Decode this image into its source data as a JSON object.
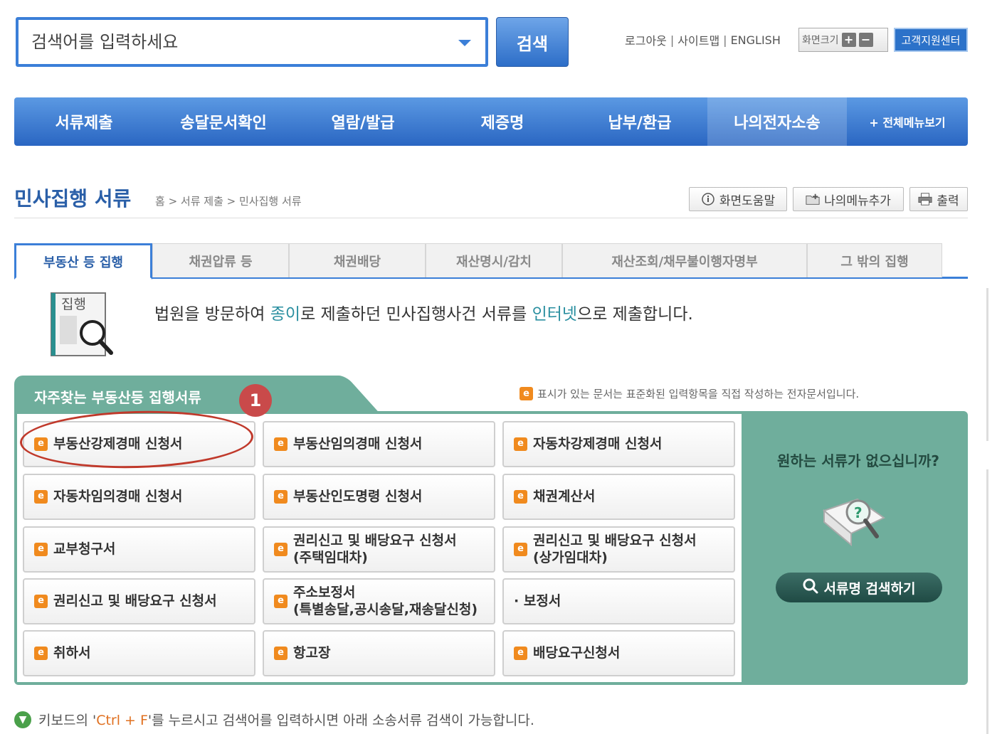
{
  "search": {
    "placeholder": "검색어를 입력하세요",
    "button": "검색"
  },
  "util": {
    "logout": "로그아웃",
    "sitemap": "사이트맵",
    "english": "ENGLISH",
    "sep": "|",
    "font_size": "화면크기",
    "plus": "+",
    "minus": "−",
    "support": "고객지원센터"
  },
  "gnb": [
    "서류제출",
    "송달문서확인",
    "열람/발급",
    "제증명",
    "납부/환급",
    "나의전자소송",
    "+ 전체메뉴보기"
  ],
  "page": {
    "title": "민사집행 서류",
    "breadcrumb": "홈 > 서류 제출 > 민사집행 서류"
  },
  "tools": {
    "help": "화면도움말",
    "add_menu": "나의메뉴추가",
    "print": "출력"
  },
  "tabs": [
    "부동산 등 집행",
    "채권압류 등",
    "채권배당",
    "재산명시/감치",
    "재산조회/채무불이행자명부",
    "그 밖의 집행"
  ],
  "intro": {
    "p1": "법원을 방문하여 ",
    "h1": "종이",
    "p2": "로 제출하던 민사집행사건 서류를 ",
    "h2": "인터넷",
    "p3": "으로 제출합니다.",
    "icon_label": "집행"
  },
  "frequent": {
    "title": "자주찾는 부동산등 집행서류",
    "badge": "1",
    "note": "표시가 있는 문서는 표준화된 입력항목을 직접 작성하는 전자문서입니다.",
    "e_letter": "e",
    "docs": [
      "부동산강제경매 신청서",
      "부동산임의경매 신청서",
      "자동차강제경매 신청서",
      "자동차임의경매 신청서",
      "부동산인도명령 신청서",
      "채권계산서",
      "교부청구서",
      "권리신고 및 배당요구 신청서\n(주택임대차)",
      "권리신고 및 배당요구 신청서\n(상가임대차)",
      "권리신고 및 배당요구 신청서",
      "주소보정서\n(특별송달,공시송달,재송달신청)",
      "· 보정서",
      "취하서",
      "항고장",
      "배당요구신청서"
    ]
  },
  "side": {
    "question": "원하는 서류가 없으십니까?",
    "search_btn": "서류명 검색하기"
  },
  "tip": {
    "p1": "키보드의 '",
    "key": "Ctrl + F",
    "p2": "'를 누르시고 검색어를 입력하시면 아래 소송서류 검색이 가능합니다."
  }
}
